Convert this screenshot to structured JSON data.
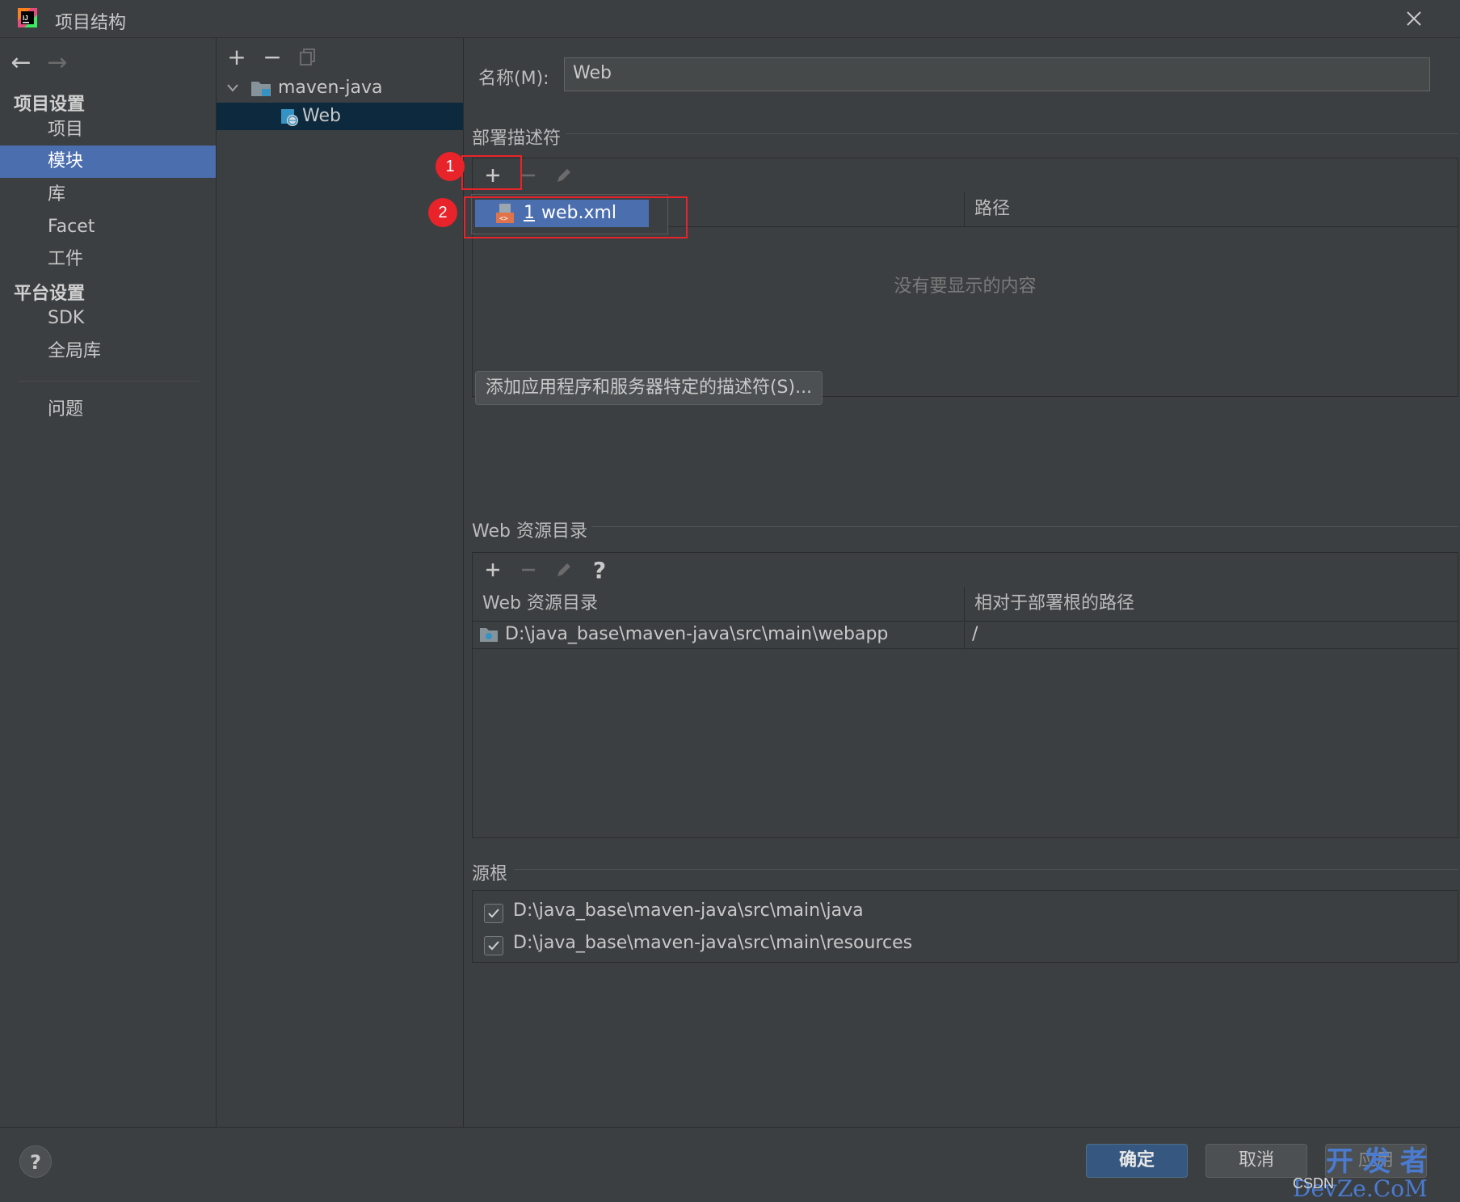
{
  "window": {
    "title": "项目结构",
    "close_icon": "close-icon"
  },
  "nav": {
    "back_icon": "←",
    "forward_icon": "→",
    "project_settings_title": "项目设置",
    "platform_settings_title": "平台设置",
    "items": [
      {
        "label": "项目"
      },
      {
        "label": "模块"
      },
      {
        "label": "库"
      },
      {
        "label": "Facet"
      },
      {
        "label": "工件"
      }
    ],
    "platform_items": [
      {
        "label": "SDK"
      },
      {
        "label": "全局库"
      }
    ],
    "problems_label": "问题",
    "selected": "模块"
  },
  "tree": {
    "toolbar": {
      "add": "+",
      "remove": "−"
    },
    "root": {
      "label": "maven-java"
    },
    "child": {
      "label": "Web"
    }
  },
  "facet": {
    "name_label": "名称(M):",
    "name_value": "Web"
  },
  "descriptors": {
    "group_title": "部署描述符",
    "columns": [
      "",
      "路径"
    ],
    "empty_text": "没有要显示的内容",
    "add_server_button": "添加应用程序和服务器特定的描述符(S)...",
    "popup_item_index": "1",
    "popup_item_label": "web.xml"
  },
  "annotations": {
    "badge1": "1",
    "badge2": "2"
  },
  "web_resources": {
    "group_title": "Web 资源目录",
    "help": "?",
    "columns": [
      "Web 资源目录",
      "相对于部署根的路径"
    ],
    "rows": [
      {
        "dir": "D:\\java_base\\maven-java\\src\\main\\webapp",
        "path": "/"
      }
    ]
  },
  "source_roots": {
    "group_title": "源根",
    "items": [
      {
        "path": "D:\\java_base\\maven-java\\src\\main\\java",
        "checked": true
      },
      {
        "path": "D:\\java_base\\maven-java\\src\\main\\resources",
        "checked": true
      }
    ]
  },
  "footer": {
    "help": "?",
    "ok": "确定",
    "cancel": "取消",
    "apply": "应用"
  },
  "watermark": {
    "csdn": "CSDN",
    "line1": "开 发 者",
    "line2": "DevZe.CoM"
  }
}
